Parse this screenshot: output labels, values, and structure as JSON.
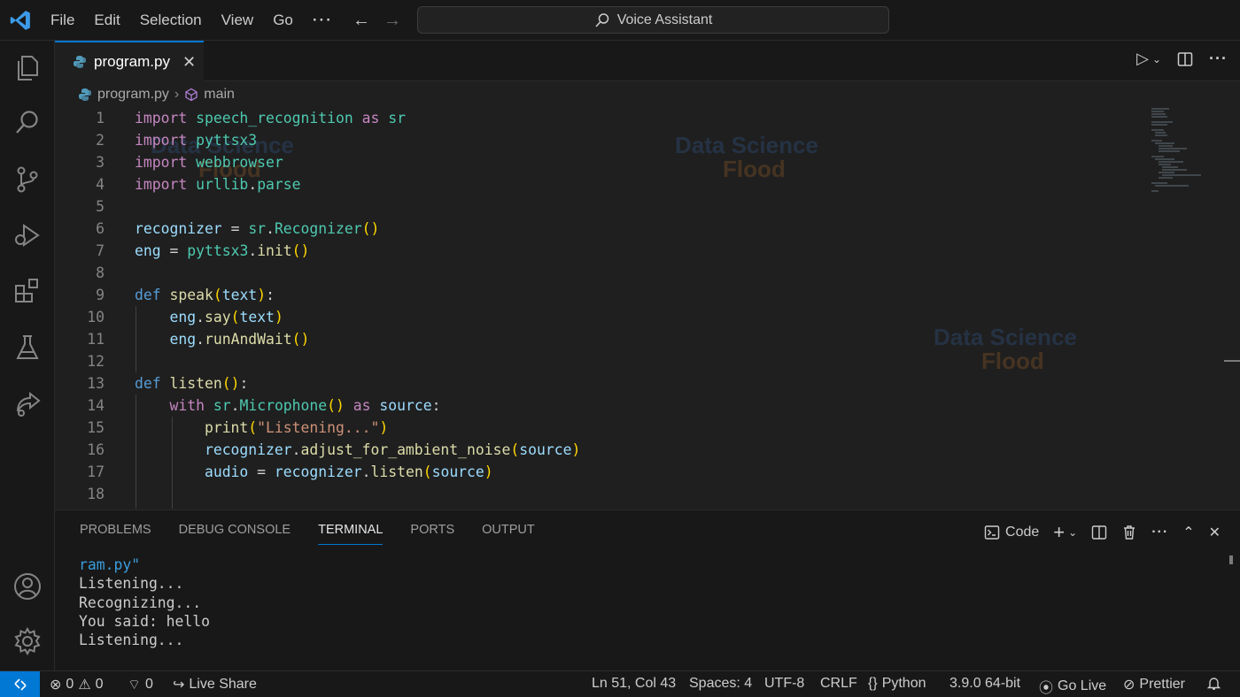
{
  "titlebar": {
    "menu": [
      "File",
      "Edit",
      "Selection",
      "View",
      "Go"
    ],
    "more": "···",
    "search_text": "Voice Assistant"
  },
  "tab": {
    "label": "program.py",
    "close": "✕"
  },
  "breadcrumb": {
    "file": "program.py",
    "symbol": "main"
  },
  "code_lines": [
    "1",
    "2",
    "3",
    "4",
    "5",
    "6",
    "7",
    "8",
    "9",
    "10",
    "11",
    "12",
    "13",
    "14",
    "15",
    "16",
    "17",
    "18"
  ],
  "panel": {
    "tabs": [
      "PROBLEMS",
      "DEBUG CONSOLE",
      "TERMINAL",
      "PORTS",
      "OUTPUT"
    ],
    "active_tab": "TERMINAL",
    "terminal_profile": "Code",
    "terminal_lines": [
      "ram.py\"",
      "Listening...",
      "Recognizing...",
      "You said: hello",
      "Listening..."
    ]
  },
  "watermark": {
    "line1": "Data Science",
    "line2": "Flood"
  },
  "statusbar": {
    "errors": "0",
    "warnings": "0",
    "ports": "0",
    "live_share": "Live Share",
    "position": "Ln 51, Col 43",
    "spaces": "Spaces: 4",
    "encoding": "UTF-8",
    "eol": "CRLF",
    "language": "Python",
    "interpreter": "3.9.0 64-bit",
    "go_live": "Go Live",
    "prettier": "Prettier"
  },
  "colors": {
    "accent": "#0078d4",
    "background": "#1f1f1f",
    "chrome": "#181818"
  }
}
